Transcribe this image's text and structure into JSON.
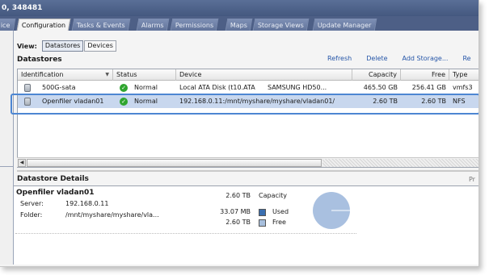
{
  "window": {
    "title": "0, 348481"
  },
  "tabs": [
    {
      "label": "ice"
    },
    {
      "label": "Configuration",
      "active": true
    },
    {
      "label": "Tasks & Events"
    },
    {
      "label": "Alarms"
    },
    {
      "label": "Permissions"
    },
    {
      "label": "Maps"
    },
    {
      "label": "Storage Views"
    },
    {
      "label": "Update Manager"
    }
  ],
  "view": {
    "label": "View:",
    "options": [
      "Datastores",
      "Devices"
    ],
    "selected": "Datastores"
  },
  "datastores": {
    "title": "Datastores",
    "actions": [
      "Refresh",
      "Delete",
      "Add Storage...",
      "Re"
    ],
    "columns": [
      "Identification",
      "Status",
      "Device",
      "Capacity",
      "Free",
      "Type"
    ],
    "rows": [
      {
        "identification": "500G-sata",
        "status": "Normal",
        "device": "Local ATA Disk (t10.ATA      SAMSUNG HD50...",
        "capacity": "465.50 GB",
        "free": "256.41 GB",
        "type": "vmfs3",
        "selected": false
      },
      {
        "identification": "Openfiler vladan01",
        "status": "Normal",
        "device": "192.168.0.11:/mnt/myshare/myshare/vladan01/",
        "capacity": "2.60 TB",
        "free": "2.60 TB",
        "type": "NFS",
        "selected": true
      }
    ]
  },
  "details": {
    "title": "Datastore Details",
    "side_label": "Pr",
    "name": "Openfiler vladan01",
    "server_label": "Server:",
    "server": "192.168.0.11",
    "folder_label": "Folder:",
    "folder": "/mnt/myshare/myshare/vla...",
    "capacity_value": "2.60 TB",
    "capacity_label": "Capacity",
    "used_value": "33.07 MB",
    "used_label": "Used",
    "free_value": "2.60 TB",
    "free_label": "Free",
    "used_fraction": 1.24e-05,
    "colors": {
      "used": "#3a6fb0",
      "free": "#a7bfdd",
      "pie": "#a9c0e0"
    }
  }
}
